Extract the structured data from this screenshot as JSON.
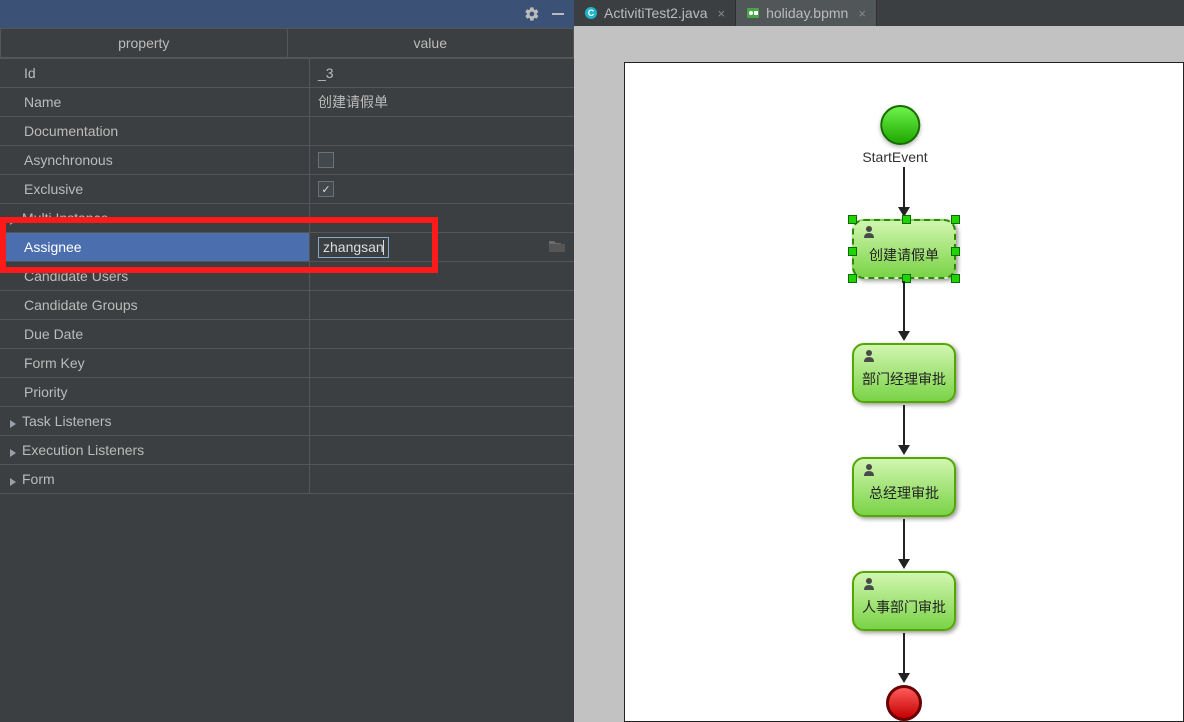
{
  "panel": {
    "headers": {
      "property": "property",
      "value": "value"
    },
    "rows": {
      "id": {
        "label": "Id",
        "value": "_3"
      },
      "name": {
        "label": "Name",
        "value": "创建请假单"
      },
      "documentation": {
        "label": "Documentation",
        "value": ""
      },
      "asynchronous": {
        "label": "Asynchronous",
        "checked": false
      },
      "exclusive": {
        "label": "Exclusive",
        "checked": true
      },
      "multi_instance": {
        "label": "Multi Instance"
      },
      "assignee": {
        "label": "Assignee",
        "value": "zhangsan"
      },
      "candidate_users": {
        "label": "Candidate Users",
        "value": ""
      },
      "candidate_groups": {
        "label": "Candidate Groups",
        "value": ""
      },
      "due_date": {
        "label": "Due Date",
        "value": ""
      },
      "form_key": {
        "label": "Form Key",
        "value": ""
      },
      "priority": {
        "label": "Priority",
        "value": ""
      },
      "task_listeners": {
        "label": "Task Listeners"
      },
      "execution_listeners": {
        "label": "Execution Listeners"
      },
      "form": {
        "label": "Form"
      }
    }
  },
  "tabs": [
    {
      "label": "ActivitiTest2.java",
      "icon": "class-icon",
      "active": false
    },
    {
      "label": "holiday.bpmn",
      "icon": "bpmn-icon",
      "active": true
    }
  ],
  "diagram": {
    "start_label": "StartEvent",
    "task1": "创建请假单",
    "task2": "部门经理审批",
    "task3": "总经理审批",
    "task4": "人事部门审批"
  }
}
